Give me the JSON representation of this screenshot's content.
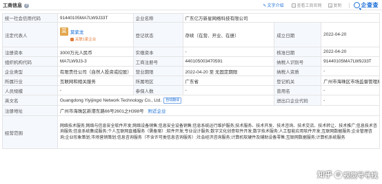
{
  "header": {
    "title": "工商信息",
    "help": "?",
    "links": [
      {
        "icon": "✎",
        "label": "文字介绍"
      },
      {
        "icon": "▢",
        "label": "查看工商官网"
      }
    ],
    "translate_icon": "A",
    "translate_label": "复制",
    "logo_label": "企查查"
  },
  "rows": {
    "r1": {
      "l1": "统一社会信用代码",
      "v1": "91440105MA7LW9J33T",
      "l2": "企业名称",
      "v2": "广东亿万新星网络科技有限公司"
    },
    "r2": {
      "l1": "法定代表人",
      "avatar": "莫",
      "name": "莫紫龙",
      "sub": "关联1家企业",
      "l2": "登记状态",
      "v2": "存续（在营、开业、在册）",
      "l3": "成立日期",
      "v3": "2022-04-20"
    },
    "r3": {
      "l1": "注册资本",
      "v1": "3000万元人民币",
      "l2": "实缴资本",
      "v2": "-",
      "l3": "核准日期",
      "v3": "2022-04-20"
    },
    "r4": {
      "l1": "组织机构代码",
      "v1": "MA7LW9J3-3",
      "l2": "工商注册号",
      "v2": "440105003470591",
      "l3": "纳税人识别号",
      "v3": "91440105MA7LW9J33T"
    },
    "r5": {
      "l1": "企业类型",
      "v1": "有限责任公司（自然人投资或控股）",
      "l2": "营业期限",
      "v2": "2022-04-20 至 无固定期限",
      "l3": "纳税人资质",
      "v3": "-"
    },
    "r6": {
      "l1": "所属行业",
      "v1": "互联网和相关服务",
      "l2": "所属地区",
      "v2": "广东省",
      "l3": "登记机关",
      "v3": "广州市海珠区市场监督管理局"
    },
    "r7": {
      "l1": "人员规模",
      "v1": "-",
      "l2": "参保人数",
      "v2": "-",
      "l3": "曾用名",
      "v3": "-"
    },
    "r8": {
      "l1": "英文名",
      "v1": "Guangdong Yiyijingxi Network Technology Co., Ltd.",
      "tag": "自动翻译",
      "l2": "进出口企业代码",
      "v2": "-"
    },
    "r9": {
      "l1": "注册地址",
      "v1": "广州市海珠区新港东路66号2601之H398号",
      "link": "附近企业"
    },
    "r10": {
      "l1": "经营范围",
      "v1": "网络技术服务;网络与信息安全软件开发;网络设备销售;信息安全设备销售;信息系统运行维护服务;技术服务、技术开发、技术咨询、技术交流、技术转让、技术推广;信息技术咨询服务;信息系统集成服务;个人互联网直播服务（需备案）;软件开发;专业设计服务;数字文化创意软件开发;数字技术服务;人工智能应用软件开发;互联网数据服务;企业管理咨询;企业形象策划;市场营销策划;信息咨询服务（不含许可类信息咨询服务）;社会经济咨询服务;计算机软硬件及辅助设备零售;互联网数据服务;计算机系统服务"
    }
  },
  "watermark": {
    "brand": "知乎",
    "at": "@",
    "handle": "视觉号寻找"
  }
}
